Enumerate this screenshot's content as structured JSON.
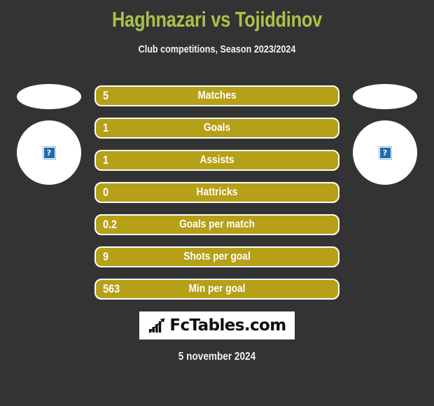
{
  "header": {
    "title": "Haghnazari vs Tojiddinov",
    "subtitle": "Club competitions, Season 2023/2024",
    "title_color": "#a9c24b",
    "subtitle_color": "#f2f2f2"
  },
  "background_color": "#333333",
  "players": {
    "left": {
      "photo_status": "broken-image",
      "placeholder_glyph": "?"
    },
    "right": {
      "photo_status": "broken-image",
      "placeholder_glyph": "?"
    }
  },
  "stats": {
    "bar_fill_color": "#b5a017",
    "bar_border_color": "#ffffff",
    "rows": [
      {
        "value": "5",
        "label": "Matches"
      },
      {
        "value": "1",
        "label": "Goals"
      },
      {
        "value": "1",
        "label": "Assists"
      },
      {
        "value": "0",
        "label": "Hattricks"
      },
      {
        "value": "0.2",
        "label": "Goals per match"
      },
      {
        "value": "9",
        "label": "Shots per goal"
      },
      {
        "value": "563",
        "label": "Min per goal"
      }
    ]
  },
  "footer": {
    "logo_text": "FcTables.com",
    "logo_icon": "bar-chart-growth-icon",
    "logo_background": "#ffffff",
    "logo_text_color": "#0d0d0d",
    "date": "5 november 2024"
  }
}
